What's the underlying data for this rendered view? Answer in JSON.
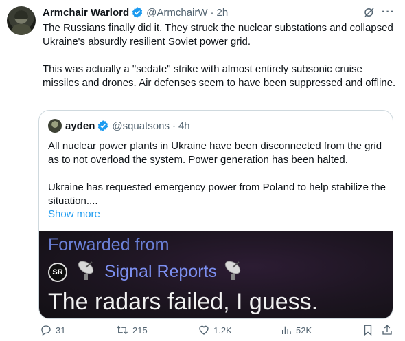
{
  "tweet": {
    "author_name": "Armchair Warlord",
    "handle": "@ArmchairW",
    "time": "2h",
    "paragraphs": [
      "The Russians finally did it.  They struck the nuclear substations and collapsed Ukraine's absurdly resilient Soviet power grid.",
      "This was actually a \"sedate\" strike with almost entirely subsonic cruise missiles and drones.  Air defenses seem to have been suppressed and offline."
    ]
  },
  "quote": {
    "author_name": "ayden",
    "handle": "@squatsons",
    "time": "4h",
    "paragraphs": [
      "All nuclear power plants in Ukraine have been disconnected from the grid as to not overload the system. Power generation has been halted.",
      "Ukraine has requested emergency power from Poland to help stabilize the situation...."
    ],
    "show_more": "Show more",
    "media": {
      "forwarded": "Forwarded from",
      "sr_logo": "SR",
      "channel": "Signal Reports",
      "caption": "The radars failed, I guess."
    }
  },
  "actions": {
    "replies": "31",
    "retweets": "215",
    "likes": "1.2K",
    "views": "52K"
  },
  "colors": {
    "link": "#1d9bf0",
    "verified": "#1d9bf0",
    "retweet": "#00ba7c",
    "muted": "#536471"
  }
}
